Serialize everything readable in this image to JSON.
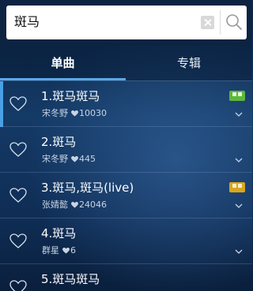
{
  "search": {
    "query": "斑马"
  },
  "tabs": [
    {
      "label": "单曲",
      "active": true
    },
    {
      "label": "专辑",
      "active": false
    }
  ],
  "songs": [
    {
      "title": "1.斑马斑马",
      "artist": "宋冬野",
      "likes": "10030",
      "badge": "hq-badge",
      "badge_color": "#5cb83c",
      "active": true
    },
    {
      "title": "2.斑马",
      "artist": "宋冬野",
      "likes": "445",
      "badge": null,
      "active": false
    },
    {
      "title": "3.斑马,斑马(live)",
      "artist": "张婧懿",
      "likes": "24046",
      "badge": "sq-badge",
      "badge_color": "#d9a520",
      "active": false
    },
    {
      "title": "4.斑马",
      "artist": "群星",
      "likes": "6",
      "badge": null,
      "active": false
    },
    {
      "title": "5.斑马斑马",
      "artist": "",
      "likes": "",
      "badge": null,
      "active": false
    }
  ],
  "colors": {
    "accent": "#5ba8e6",
    "background": "#143a66"
  },
  "icons": {
    "heart": "heart-outline-icon",
    "chevron": "chevron-down-icon",
    "search": "search-icon",
    "clear": "clear-icon"
  }
}
